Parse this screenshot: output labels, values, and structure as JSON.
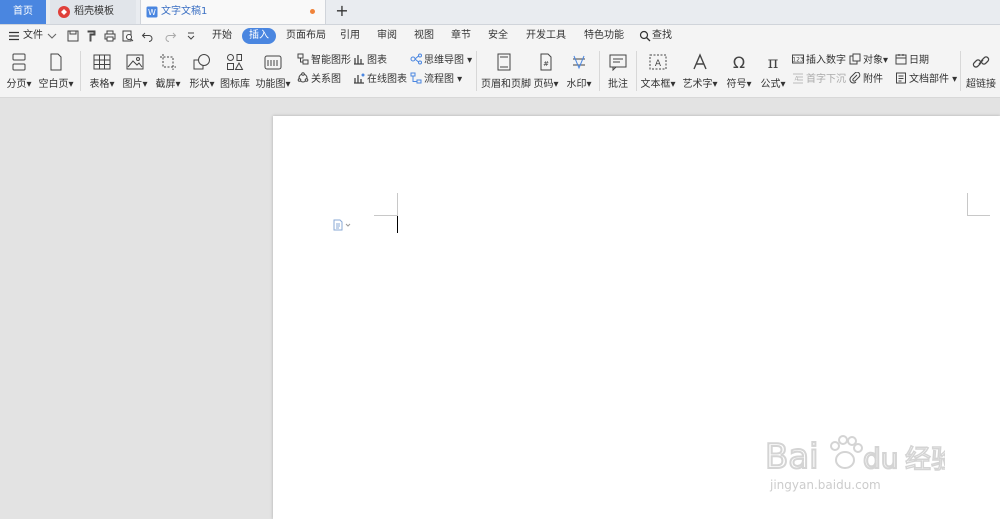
{
  "tabs": {
    "home": "首页",
    "template": "稻壳模板",
    "document": "文字文稿1"
  },
  "menu": {
    "file": "文件",
    "items": [
      "开始",
      "插入",
      "页面布局",
      "引用",
      "审阅",
      "视图",
      "章节",
      "安全",
      "开发工具",
      "特色功能"
    ],
    "active": "插入",
    "search": "查找"
  },
  "ribbon": {
    "page_break": "分页",
    "blank_page": "空白页",
    "table": "表格",
    "picture": "图片",
    "screenshot": "截屏",
    "shape": "形状",
    "icon_library": "图标库",
    "function_chart": "功能图",
    "smart_art": "智能图形",
    "chart": "图表",
    "mind_map": "思维导图",
    "relation_chart": "关系图",
    "online_chart": "在线图表",
    "flowchart": "流程图",
    "header_footer": "页眉和页脚",
    "page_number": "页码",
    "watermark": "水印",
    "comment": "批注",
    "text_box": "文本框",
    "word_art": "艺术字",
    "symbol": "符号",
    "formula": "公式",
    "insert_number": "插入数字",
    "drop_cap": "首字下沉",
    "object": "对象",
    "attachment": "附件",
    "date": "日期",
    "doc_parts": "文档部件",
    "hyperlink": "超链接"
  },
  "watermark_text": {
    "brand": "Bai du 经验",
    "url": "jingyan.baidu.com"
  },
  "colors": {
    "accent": "#4a86e0",
    "modified_dot": "#f0833a",
    "brand_red": "#e0403a"
  }
}
